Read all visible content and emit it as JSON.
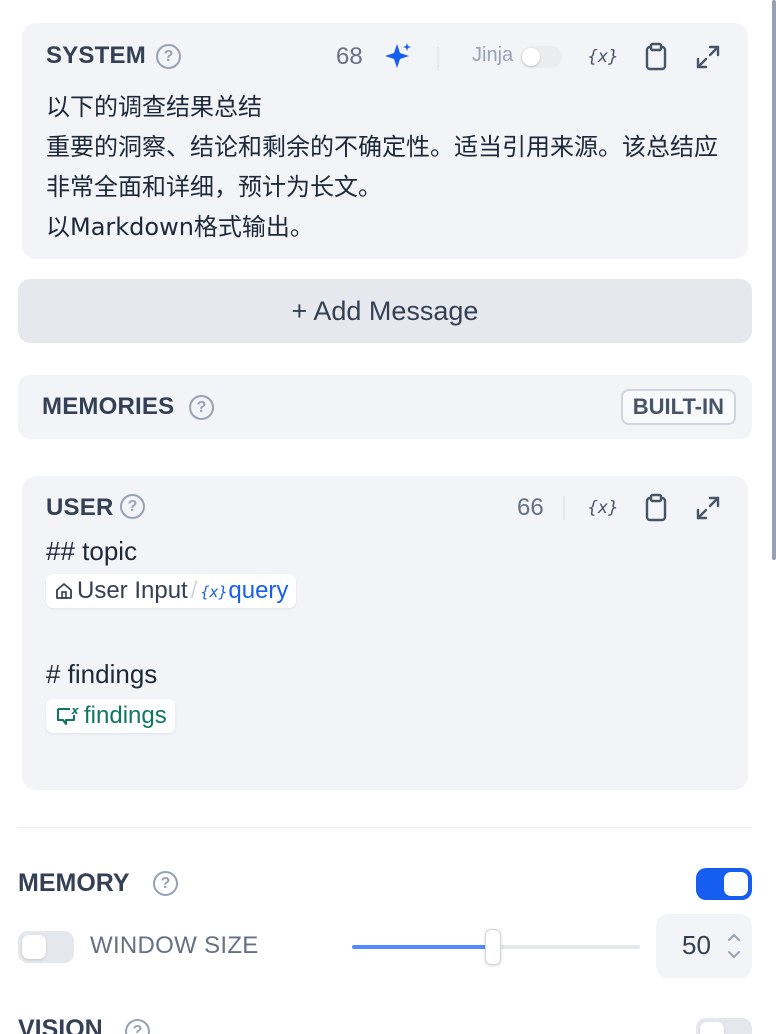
{
  "system": {
    "title": "SYSTEM",
    "count": "68",
    "jinja_label": "Jinja",
    "text": " 以下的调查结果总结\n重要的洞察、结论和剩余的不确定性。适当引用来源。该总结应非常全面和详细，预计为长文。\n以Markdown格式输出。"
  },
  "add_message": {
    "label": "+ Add Message"
  },
  "memories": {
    "title": "MEMORIES",
    "badge": "BUILT-IN"
  },
  "user": {
    "title": "USER",
    "count": "66",
    "line_topic": "## topic",
    "chip_input": {
      "source": "User Input",
      "separator": "/",
      "var": "query"
    },
    "line_findings": "# findings",
    "chip_findings": {
      "var": "findings"
    }
  },
  "memory_section": {
    "title": "MEMORY",
    "enabled": true,
    "window_size": {
      "label": "WINDOW SIZE",
      "enabled": false,
      "value": "50",
      "slider_fraction": 0.49
    }
  },
  "vision_section": {
    "title": "VISION"
  },
  "icons": {
    "help": "question-circle-icon",
    "sparkle": "sparkle-icon",
    "variable": "variable-icon",
    "copy": "clipboard-icon",
    "expand": "expand-icon",
    "home": "home-icon"
  },
  "colors": {
    "accent": "#155eef",
    "card_bg": "#f2f4f7",
    "chip_blue": "#155eef",
    "chip_green": "#0e7663"
  }
}
